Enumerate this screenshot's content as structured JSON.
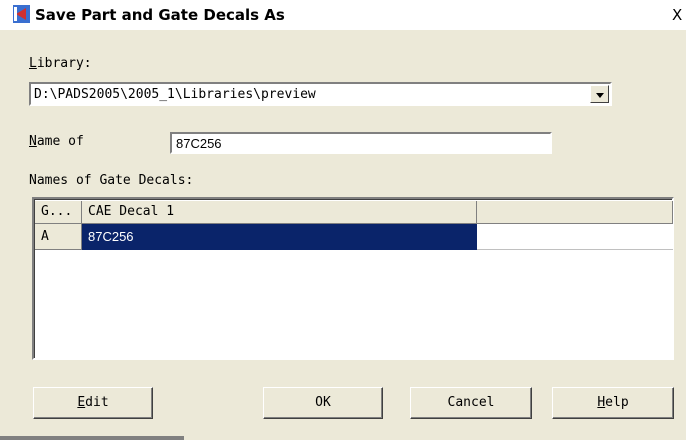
{
  "window": {
    "title": "Save Part and Gate Decals As",
    "close_glyph": "X",
    "icon": "app-icon"
  },
  "library": {
    "label_prefix": "L",
    "label_rest": "ibrary:",
    "value": "D:\\PADS2005\\2005_1\\Libraries\\preview",
    "dropdown_icon": "chevron-down-icon"
  },
  "name_field": {
    "label_prefix": "N",
    "label_rest": "ame of",
    "value": "87C256"
  },
  "gate_decals": {
    "label": "Names of Gate Decals:",
    "columns": [
      "G...",
      "CAE Decal 1",
      ""
    ],
    "rows": [
      {
        "gate": "A",
        "decal": "87C256",
        "extra": ""
      }
    ]
  },
  "buttons": {
    "edit_prefix": "E",
    "edit_rest": "dit",
    "ok": "OK",
    "cancel": "Cancel",
    "help_prefix": "H",
    "help_rest": "elp"
  },
  "colors": {
    "dialog_bg": "#ece9d8",
    "selection": "#0a246a",
    "icon_blue": "#3a6fd0",
    "icon_red": "#d03030"
  }
}
